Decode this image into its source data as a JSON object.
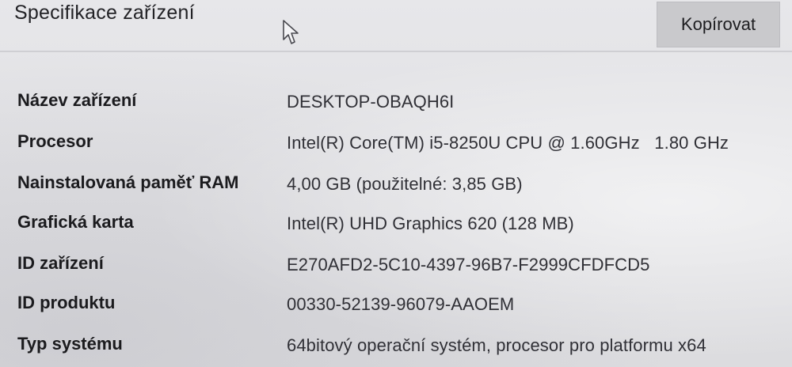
{
  "section": {
    "title": "Specifikace zařízení",
    "copy_label": "Kopírovat"
  },
  "specs": [
    {
      "label": "Název zařízení",
      "value": "DESKTOP-OBAQH6I"
    },
    {
      "label": "Procesor",
      "value": "Intel(R) Core(TM) i5-8250U CPU @ 1.60GHz   1.80 GHz"
    },
    {
      "label": "Nainstalovaná paměť RAM",
      "value": "4,00 GB (použitelné: 3,85 GB)"
    },
    {
      "label": "Grafická karta",
      "value": "Intel(R) UHD Graphics 620 (128 MB)"
    },
    {
      "label": "ID zařízení",
      "value": "E270AFD2-5C10-4397-96B7-F2999CFDFCD5"
    },
    {
      "label": "ID produktu",
      "value": "00330-52139-96079-AAOEM"
    },
    {
      "label": "Typ systému",
      "value": "64bitový operační systém, procesor pro platformu x64"
    }
  ],
  "icons": {
    "cursor": "mouse-pointer-icon"
  }
}
